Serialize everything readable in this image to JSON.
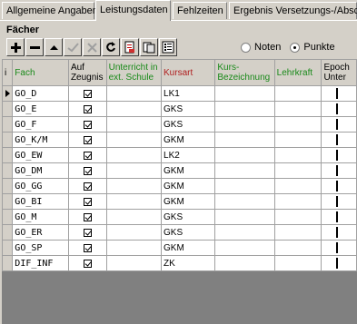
{
  "tabs": [
    {
      "label": "Allgemeine Angaben"
    },
    {
      "label": "Leistungsdaten"
    },
    {
      "label": "Fehlzeiten"
    },
    {
      "label": "Ergebnis Versetzungs-/Absch"
    }
  ],
  "panel": {
    "title": "Fächer"
  },
  "toolbar": {
    "buttons": [
      {
        "icon": "plus-icon"
      },
      {
        "icon": "minus-icon"
      },
      {
        "icon": "triangle-up-icon"
      },
      {
        "icon": "checkmark-icon"
      },
      {
        "icon": "cancel-x-icon"
      },
      {
        "icon": "refresh-icon"
      },
      {
        "icon": "document-icon"
      },
      {
        "icon": "copy-icon"
      },
      {
        "icon": "checklist-icon"
      }
    ]
  },
  "mode": {
    "options": [
      "Noten",
      "Punkte"
    ],
    "selected": "Punkte"
  },
  "grid": {
    "headers": {
      "indicator": "i",
      "fach": "Fach",
      "auf_zeugnis": "Auf Zeugnis",
      "unterricht": "Unterricht in ext. Schule",
      "kursart": "Kursart",
      "kurs_bez": "Kurs-Bezeichnung",
      "lehrkraft": "Lehrkraft",
      "epoch": "Epoch Unter"
    },
    "rows": [
      {
        "fach": "GO_D",
        "zeugnis": true,
        "kursart": "LK1"
      },
      {
        "fach": "GO_E",
        "zeugnis": true,
        "kursart": "GKS"
      },
      {
        "fach": "GO_F",
        "zeugnis": true,
        "kursart": "GKS"
      },
      {
        "fach": "GO_K/M",
        "zeugnis": true,
        "kursart": "GKM"
      },
      {
        "fach": "GO_EW",
        "zeugnis": true,
        "kursart": "LK2"
      },
      {
        "fach": "GO_DM",
        "zeugnis": true,
        "kursart": "GKM"
      },
      {
        "fach": "GO_GG",
        "zeugnis": true,
        "kursart": "GKM"
      },
      {
        "fach": "GO_BI",
        "zeugnis": true,
        "kursart": "GKM"
      },
      {
        "fach": "GO_M",
        "zeugnis": true,
        "kursart": "GKS"
      },
      {
        "fach": "GO_ER",
        "zeugnis": true,
        "kursart": "GKS"
      },
      {
        "fach": "GO_SP",
        "zeugnis": true,
        "kursart": "GKM"
      },
      {
        "fach": "DIF_INF",
        "zeugnis": true,
        "kursart": "ZK"
      }
    ]
  }
}
